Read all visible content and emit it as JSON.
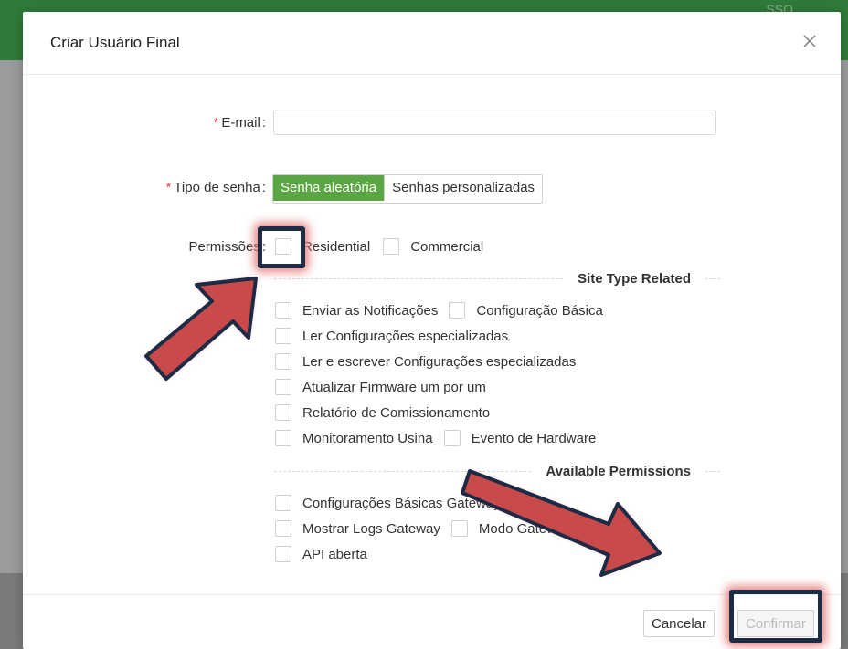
{
  "background": {
    "header_text": "SSO"
  },
  "modal": {
    "title": "Criar Usuário Final",
    "close_icon": "close-icon"
  },
  "form": {
    "email": {
      "required_mark": "*",
      "label": "E-mail",
      "colon": ":",
      "value": "",
      "placeholder": ""
    },
    "password_type": {
      "required_mark": "*",
      "label": "Tipo de senha",
      "colon": ":",
      "options": [
        "Senha aleatória",
        "Senhas personalizadas"
      ],
      "selected": "Senha aleatória"
    },
    "permissions": {
      "label": "Permissões",
      "colon": ":",
      "options": [
        "Residential",
        "Commercial"
      ]
    },
    "site_type_related": {
      "title": "Site Type Related",
      "items": [
        "Enviar as Notificações",
        "Configuração Básica",
        "Ler Configurações especializadas",
        "Ler e escrever Configurações especializadas",
        "Atualizar Firmware um por um",
        "Relatório de Comissionamento",
        "Monitoramento Usina",
        "Evento de Hardware"
      ]
    },
    "available_permissions": {
      "title": "Available Permissions",
      "items": [
        "Configurações Básicas Gateway",
        "Mostrar Logs Gateway",
        "Modo Gateway",
        "API aberta"
      ]
    }
  },
  "footer": {
    "cancel": "Cancelar",
    "confirm": "Confirmar"
  },
  "colors": {
    "accent": "#5aa642",
    "required": "#e04848",
    "annotation": "#1d2b44",
    "arrow": "#c94a4a"
  }
}
